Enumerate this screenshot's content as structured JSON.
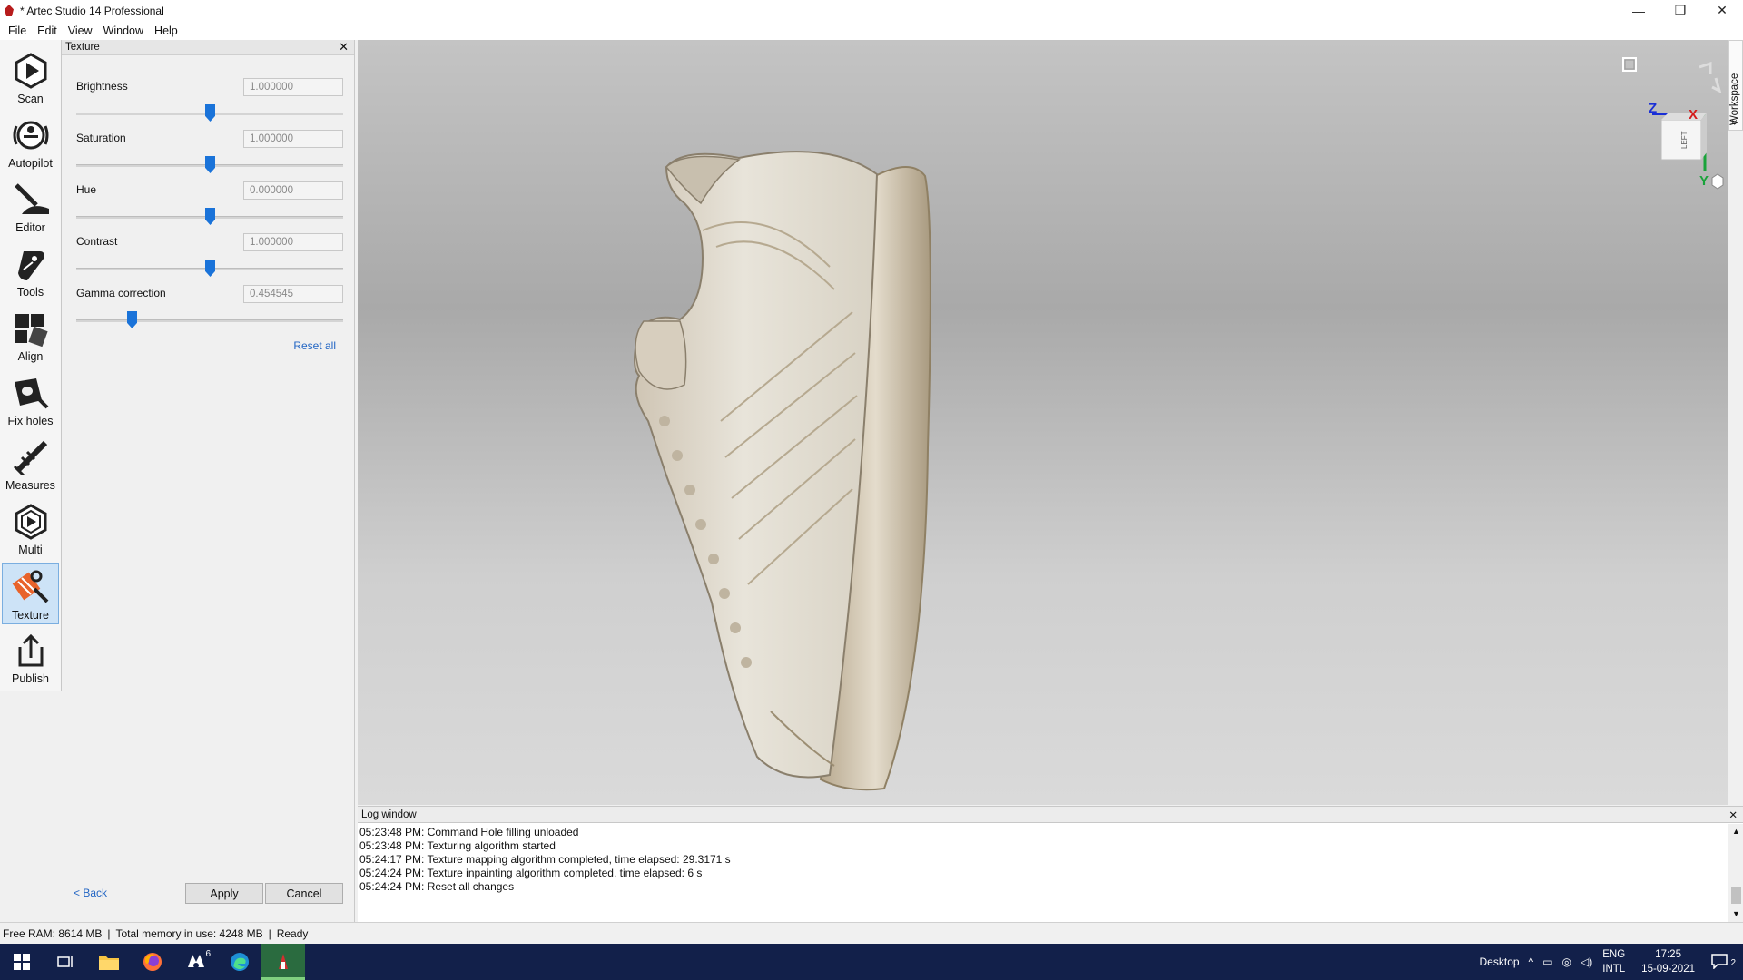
{
  "window": {
    "title": "* Artec Studio 14 Professional",
    "minimize": "—",
    "maximize": "❐",
    "close": "✕"
  },
  "menu": [
    "File",
    "Edit",
    "View",
    "Window",
    "Help"
  ],
  "toolbar": [
    "Scan",
    "Autopilot",
    "Editor",
    "Tools",
    "Align",
    "Fix holes",
    "Measures",
    "Multi",
    "Texture",
    "Publish"
  ],
  "panel": {
    "title": "Texture",
    "params": [
      {
        "label": "Brightness",
        "value": "1.000000",
        "level": 0.5
      },
      {
        "label": "Saturation",
        "value": "1.000000",
        "level": 0.5
      },
      {
        "label": "Hue",
        "value": "0.000000",
        "level": 0.5
      },
      {
        "label": "Contrast",
        "value": "1.000000",
        "level": 0.5
      },
      {
        "label": "Gamma correction",
        "value": "0.454545",
        "level": 0.21
      }
    ],
    "reset_all": "Reset all",
    "back": "< Back",
    "apply": "Apply",
    "cancel": "Cancel"
  },
  "viewport": {
    "workspace_tab": "Workspace",
    "axes": {
      "z": "Z",
      "x": "X",
      "y": "Y"
    },
    "cube_face": "LEFT"
  },
  "log": {
    "title": "Log window",
    "lines": [
      "05:23:48 PM: Command Hole filling unloaded",
      "05:23:48 PM: Texturing algorithm started",
      "05:24:17 PM: Texture mapping algorithm completed, time elapsed: 29.3171 s",
      "05:24:24 PM: Texture inpainting algorithm completed, time elapsed: 6 s",
      "05:24:24 PM: Reset all changes"
    ]
  },
  "status": {
    "free_ram": "Free RAM: 8614 MB",
    "total_memory": "Total memory in use: 4248 MB",
    "state": "Ready"
  },
  "taskbar": {
    "desktop": "Desktop",
    "lang": "ENG",
    "layout": "INTL",
    "time": "17:25",
    "date": "15-09-2021",
    "notifications": "2",
    "badge": "6"
  }
}
